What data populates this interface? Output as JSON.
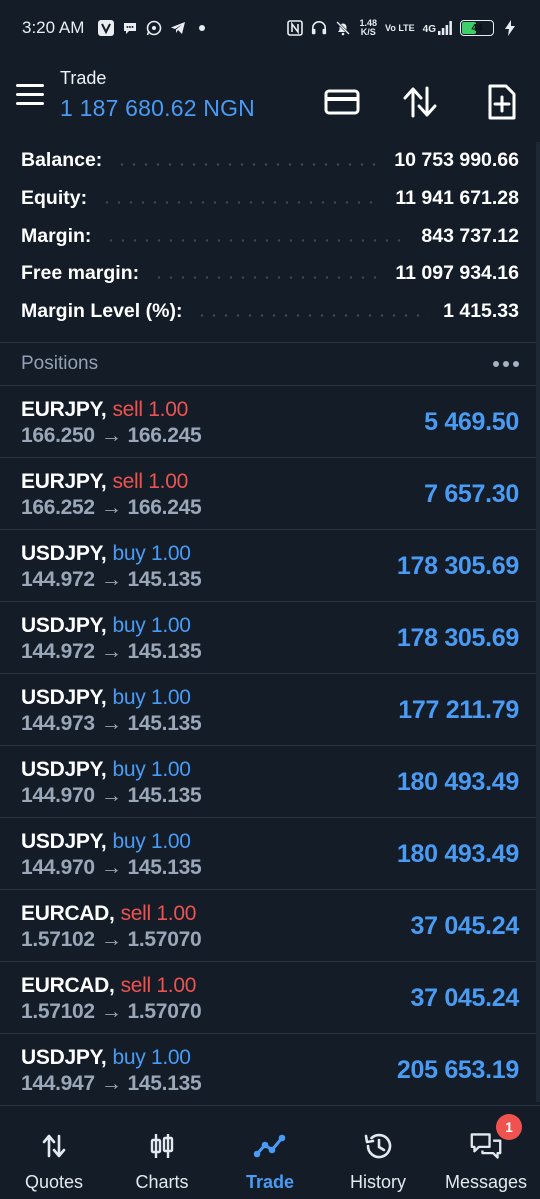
{
  "status_bar": {
    "time": "3:20 AM",
    "net_speed_value": "1.48",
    "net_speed_unit": "K/S",
    "volte": "Vo LTE",
    "network": "4G",
    "battery": "44"
  },
  "header": {
    "title": "Trade",
    "balance": "1 187 680.62 NGN",
    "icons": [
      "menu-icon",
      "card-icon",
      "sort-arrows-icon",
      "new-order-icon"
    ]
  },
  "summary": [
    {
      "label": "Balance:",
      "value": "10 753 990.66"
    },
    {
      "label": "Equity:",
      "value": "11 941 671.28"
    },
    {
      "label": "Margin:",
      "value": "843 737.12"
    },
    {
      "label": "Free margin:",
      "value": "11 097 934.16"
    },
    {
      "label": "Margin Level (%):",
      "value": "1 415.33"
    }
  ],
  "positions_header": {
    "label": "Positions"
  },
  "positions": [
    {
      "symbol": "EURJPY,",
      "side": "sell 1.00",
      "side_type": "sell",
      "open": "166.250",
      "arrow": "→",
      "current": "166.245",
      "profit": "5 469.50"
    },
    {
      "symbol": "EURJPY,",
      "side": "sell 1.00",
      "side_type": "sell",
      "open": "166.252",
      "arrow": "→",
      "current": "166.245",
      "profit": "7 657.30"
    },
    {
      "symbol": "USDJPY,",
      "side": "buy 1.00",
      "side_type": "buy",
      "open": "144.972",
      "arrow": "→",
      "current": "145.135",
      "profit": "178 305.69"
    },
    {
      "symbol": "USDJPY,",
      "side": "buy 1.00",
      "side_type": "buy",
      "open": "144.972",
      "arrow": "→",
      "current": "145.135",
      "profit": "178 305.69"
    },
    {
      "symbol": "USDJPY,",
      "side": "buy 1.00",
      "side_type": "buy",
      "open": "144.973",
      "arrow": "→",
      "current": "145.135",
      "profit": "177 211.79"
    },
    {
      "symbol": "USDJPY,",
      "side": "buy 1.00",
      "side_type": "buy",
      "open": "144.970",
      "arrow": "→",
      "current": "145.135",
      "profit": "180 493.49"
    },
    {
      "symbol": "USDJPY,",
      "side": "buy 1.00",
      "side_type": "buy",
      "open": "144.970",
      "arrow": "→",
      "current": "145.135",
      "profit": "180 493.49"
    },
    {
      "symbol": "EURCAD,",
      "side": "sell 1.00",
      "side_type": "sell",
      "open": "1.57102",
      "arrow": "→",
      "current": "1.57070",
      "profit": "37 045.24"
    },
    {
      "symbol": "EURCAD,",
      "side": "sell 1.00",
      "side_type": "sell",
      "open": "1.57102",
      "arrow": "→",
      "current": "1.57070",
      "profit": "37 045.24"
    },
    {
      "symbol": "USDJPY,",
      "side": "buy 1.00",
      "side_type": "buy",
      "open": "144.947",
      "arrow": "→",
      "current": "145.135",
      "profit": "205 653.19"
    }
  ],
  "nav": {
    "items": [
      {
        "label": "Quotes",
        "icon": "quotes-icon"
      },
      {
        "label": "Charts",
        "icon": "charts-icon"
      },
      {
        "label": "Trade",
        "icon": "trade-icon",
        "active": true
      },
      {
        "label": "History",
        "icon": "history-icon"
      },
      {
        "label": "Messages",
        "icon": "messages-icon",
        "badge": "1"
      }
    ]
  },
  "colors": {
    "background": "#131c27",
    "accent": "#4a9bf3",
    "sell": "#f0524f",
    "muted": "#9aa7b8"
  }
}
